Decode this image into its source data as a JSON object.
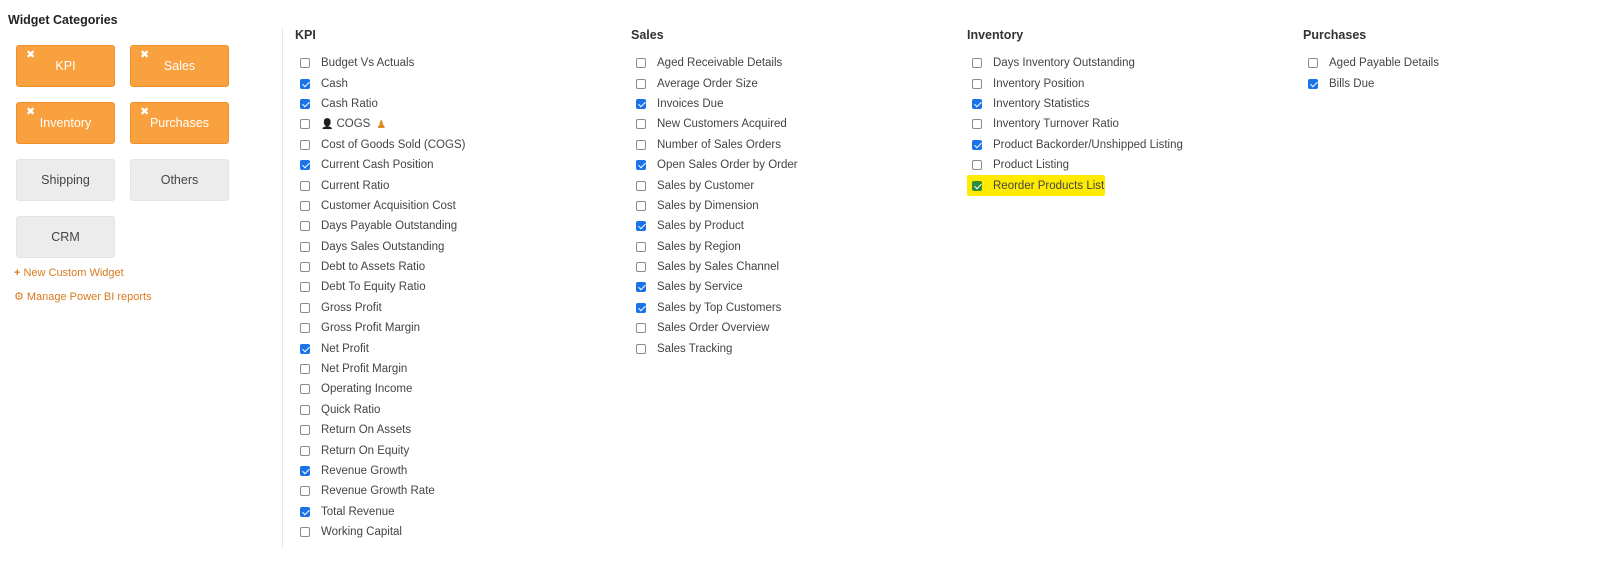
{
  "sidebar": {
    "title": "Widget Categories",
    "categories": [
      {
        "label": "KPI"
      },
      {
        "label": "Sales"
      },
      {
        "label": "Inventory"
      },
      {
        "label": "Purchases"
      },
      {
        "label": "Shipping"
      },
      {
        "label": "Others"
      },
      {
        "label": "CRM"
      }
    ],
    "new_custom_widget": "New Custom Widget",
    "manage_power_bi": "Manage Power BI reports"
  },
  "columns": {
    "kpi": {
      "title": "KPI",
      "items": [
        {
          "label": "Budget Vs Actuals",
          "checked": false
        },
        {
          "label": "Cash",
          "checked": true
        },
        {
          "label": "Cash Ratio",
          "checked": true
        },
        {
          "label": "COGS",
          "checked": false
        },
        {
          "label": "Cost of Goods Sold (COGS)",
          "checked": false
        },
        {
          "label": "Current Cash Position",
          "checked": true
        },
        {
          "label": "Current Ratio",
          "checked": false
        },
        {
          "label": "Customer Acquisition Cost",
          "checked": false
        },
        {
          "label": "Days Payable Outstanding",
          "checked": false
        },
        {
          "label": "Days Sales Outstanding",
          "checked": false
        },
        {
          "label": "Debt to Assets Ratio",
          "checked": false
        },
        {
          "label": "Debt To Equity Ratio",
          "checked": false
        },
        {
          "label": "Gross Profit",
          "checked": false
        },
        {
          "label": "Gross Profit Margin",
          "checked": false
        },
        {
          "label": "Net Profit",
          "checked": true
        },
        {
          "label": "Net Profit Margin",
          "checked": false
        },
        {
          "label": "Operating Income",
          "checked": false
        },
        {
          "label": "Quick Ratio",
          "checked": false
        },
        {
          "label": "Return On Assets",
          "checked": false
        },
        {
          "label": "Return On Equity",
          "checked": false
        },
        {
          "label": "Revenue Growth",
          "checked": true
        },
        {
          "label": "Revenue Growth Rate",
          "checked": false
        },
        {
          "label": "Total Revenue",
          "checked": true
        },
        {
          "label": "Working Capital",
          "checked": false
        }
      ]
    },
    "sales": {
      "title": "Sales",
      "items": [
        {
          "label": "Aged Receivable Details",
          "checked": false
        },
        {
          "label": "Average Order Size",
          "checked": false
        },
        {
          "label": "Invoices Due",
          "checked": true
        },
        {
          "label": "New Customers Acquired",
          "checked": false
        },
        {
          "label": "Number of Sales Orders",
          "checked": false
        },
        {
          "label": "Open Sales Order by Order",
          "checked": true
        },
        {
          "label": "Sales by Customer",
          "checked": false
        },
        {
          "label": "Sales by Dimension",
          "checked": false
        },
        {
          "label": "Sales by Product",
          "checked": true
        },
        {
          "label": "Sales by Region",
          "checked": false
        },
        {
          "label": "Sales by Sales Channel",
          "checked": false
        },
        {
          "label": "Sales by Service",
          "checked": true
        },
        {
          "label": "Sales by Top Customers",
          "checked": true
        },
        {
          "label": "Sales Order Overview",
          "checked": false
        },
        {
          "label": "Sales Tracking",
          "checked": false
        }
      ]
    },
    "inventory": {
      "title": "Inventory",
      "items": [
        {
          "label": "Days Inventory Outstanding",
          "checked": false
        },
        {
          "label": "Inventory Position",
          "checked": false
        },
        {
          "label": "Inventory Statistics",
          "checked": true
        },
        {
          "label": "Inventory Turnover Ratio",
          "checked": false
        },
        {
          "label": "Product Backorder/Unshipped Listing",
          "checked": true
        },
        {
          "label": "Product Listing",
          "checked": false
        },
        {
          "label": "Reorder Products List",
          "checked": true
        }
      ]
    },
    "purchases": {
      "title": "Purchases",
      "items": [
        {
          "label": "Aged Payable Details",
          "checked": false
        },
        {
          "label": "Bills Due",
          "checked": true
        }
      ]
    }
  },
  "colors": {
    "accent": "#f9a03f",
    "link": "#d97a1c",
    "checkbox_checked": "#1a73e8",
    "highlight": "#ffeb00"
  }
}
